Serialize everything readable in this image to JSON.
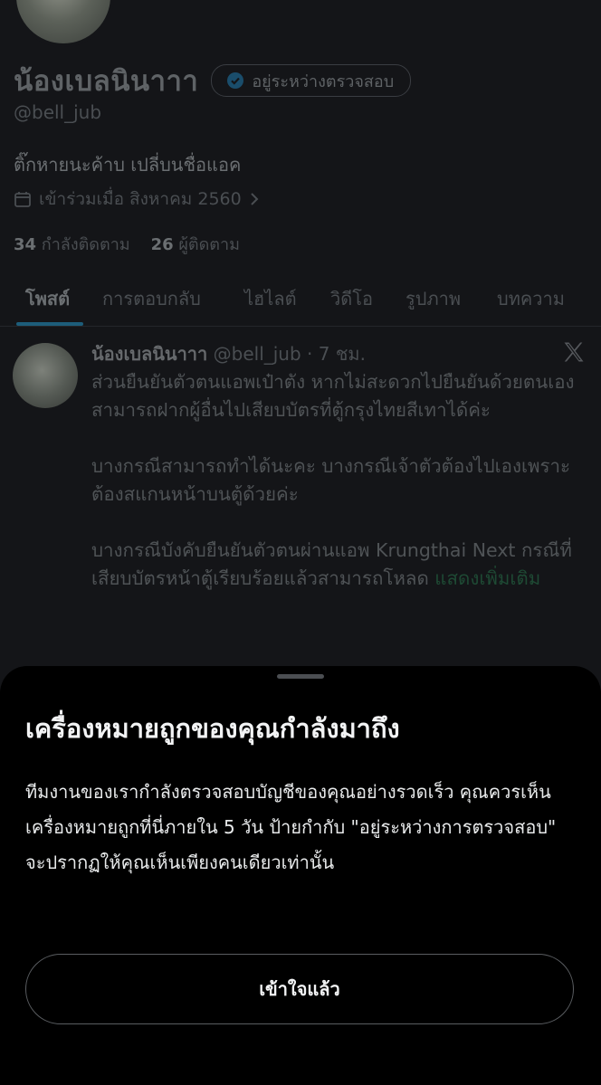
{
  "profile": {
    "name": "น้องเบลนินาาา",
    "verification_badge": "อยู่ระหว่างตรวจสอบ",
    "handle": "@bell_jub",
    "bio": "ติ๊กหายนะค้าบ เปลี่บนชื่อแอค",
    "joined": "เข้าร่วมเมื่อ สิงหาคม 2560",
    "following_count": "34",
    "following_label": "กำลังติดตาม",
    "followers_count": "26",
    "followers_label": "ผู้ติดตาม"
  },
  "tabs": [
    "โพสต์",
    "การตอบกลับ",
    "ไฮไลต์",
    "วิดีโอ",
    "รูปภาพ",
    "บทความ"
  ],
  "post": {
    "author": "น้องเบลนินาาา",
    "meta": "@bell_jub · 7 ชม.",
    "paragraphs": [
      "ส่วนยืนยันตัวตนแอพเป๋าตัง หากไม่สะดวกไปยืนยันด้วยตนเอง สามารถฝากผู้อื่นไปเสียบบัตรที่ตู้กรุงไทยสีเทาได้ค่ะ",
      "บางกรณีสามารถทำได้นะคะ บางกรณีเจ้าตัวต้องไปเองเพราะต้องสแกนหน้าบนตู้ด้วยค่ะ",
      "บางกรณีบังคับยืนยันตัวตนผ่านแอพ Krungthai Next กรณีที่เสียบบัตรหน้าตู้เรียบร้อยแล้วสามารถโหลด"
    ],
    "show_more": "แสดงเพิ่มเติม"
  },
  "sheet": {
    "title": "เครื่องหมายถูกของคุณกำลังมาถึง",
    "body": "ทีมงานของเรากำลังตรวจสอบบัญชีของคุณอย่างรวดเร็ว คุณควรเห็นเครื่องหมายถูกที่นี่ภายใน 5 วัน ป้ายกำกับ \"อยู่ระหว่างการตรวจสอบ\" จะปรากฏให้คุณเห็นเพียงคนเดียวเท่านั้น",
    "button": "เข้าใจแล้ว"
  },
  "icons": [
    "verified-check-icon",
    "calendar-icon",
    "chevron-right-icon",
    "x-logo-icon"
  ],
  "colors": {
    "accent_blue": "#1d9bf0",
    "link_green": "#00ba7c",
    "sheet_bg": "#000000"
  }
}
